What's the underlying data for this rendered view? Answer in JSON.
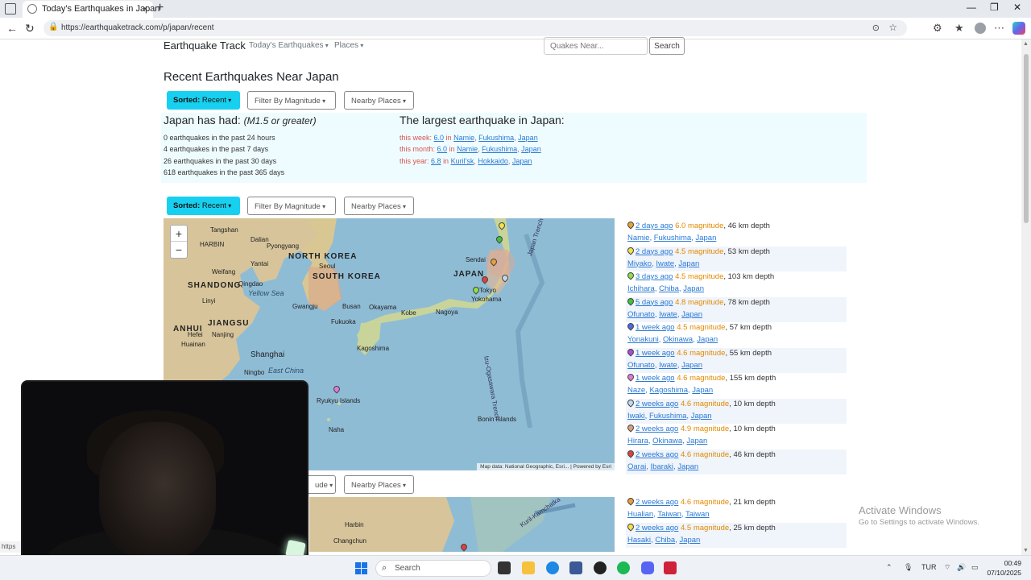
{
  "browser": {
    "tab_title": "Today's Earthquakes in Japan",
    "url": "https://earthquaketrack.com/p/japan/recent",
    "status_url": "https"
  },
  "navbar": {
    "brand": "Earthquake Track",
    "links": [
      "Today's Earthquakes",
      "Places"
    ],
    "search_placeholder": "Quakes Near...",
    "search_button": "Search"
  },
  "page": {
    "title": "Recent Earthquakes Near Japan"
  },
  "filters": {
    "sorted_label": "Sorted:",
    "sorted_value": "Recent",
    "magnitude": "Filter By Magnitude",
    "places": "Nearby Places",
    "magnitude_cut": "ude"
  },
  "stats": {
    "heading": "Japan has had:",
    "heading_note": "(M1.5 or greater)",
    "lines": [
      "0 earthquakes in the past 24 hours",
      "4 earthquakes in the past 7 days",
      "26 earthquakes in the past 30 days",
      "618 earthquakes in the past 365 days"
    ]
  },
  "largest": {
    "heading": "The largest earthquake in Japan:",
    "rows": [
      {
        "label": "this week:",
        "mag": "6.0",
        "sep": "in",
        "place": [
          "Namie",
          "Fukushima",
          "Japan"
        ]
      },
      {
        "label": "this month:",
        "mag": "6.0",
        "sep": "in",
        "place": [
          "Namie",
          "Fukushima",
          "Japan"
        ]
      },
      {
        "label": "this year:",
        "mag": "6.8",
        "sep": "in",
        "place": [
          "Kuril'sk",
          "Hokkaido",
          "Japan"
        ]
      }
    ]
  },
  "map": {
    "labels": [
      "HARBIN",
      "Tangshan",
      "Dalian",
      "Pyongyang",
      "NORTH KOREA",
      "Yantai",
      "Seoul",
      "SOUTH KOREA",
      "Busan",
      "Gwangju",
      "Qingdao",
      "Yellow Sea",
      "Weifang",
      "Linyi",
      "SHANDONG",
      "JAPAN",
      "Sendai",
      "Tokyo",
      "Kobe",
      "Okayama",
      "Nagoya",
      "Yokohama",
      "Fukuoka",
      "Kagoshima",
      "ANHUI",
      "JIANGSU",
      "Nanjing",
      "Hefei",
      "Huainan",
      "Shanghai",
      "Ningbo",
      "East China",
      "Ryukyu Islands",
      "Naha",
      "Bonin Islands",
      "Izu-Ogasawara Trench",
      "Japan Trench"
    ],
    "attribution": "Map data: National Geographic, Esri... | Powered by Esri",
    "map2_labels": [
      "Harbin",
      "Changchun",
      "Kuril-Kamchatka"
    ]
  },
  "quakes": [
    {
      "ago": "2 days ago",
      "mag": "6.0",
      "mag_label": "magnitude",
      "depth": ", 46 km depth",
      "place": [
        "Namie",
        "Fukushima",
        "Japan"
      ],
      "pin": "#e8a13a"
    },
    {
      "ago": "2 days ago",
      "mag": "4.5",
      "mag_label": "magnitude",
      "depth": ", 53 km depth",
      "place": [
        "Miyako",
        "Iwate",
        "Japan"
      ],
      "pin": "#f4e14b"
    },
    {
      "ago": "3 days ago",
      "mag": "4.5",
      "mag_label": "magnitude",
      "depth": ", 103 km depth",
      "place": [
        "Ichihara",
        "Chiba",
        "Japan"
      ],
      "pin": "#8be04b"
    },
    {
      "ago": "5 days ago",
      "mag": "4.8",
      "mag_label": "magnitude",
      "depth": ", 78 km depth",
      "place": [
        "Ofunato",
        "Iwate",
        "Japan"
      ],
      "pin": "#3cc43c"
    },
    {
      "ago": "1 week ago",
      "mag": "4.5",
      "mag_label": "magnitude",
      "depth": ", 57 km depth",
      "place": [
        "Yonakuni",
        "Okinawa",
        "Japan"
      ],
      "pin": "#4a6be0"
    },
    {
      "ago": "1 week ago",
      "mag": "4.6",
      "mag_label": "magnitude",
      "depth": ", 55 km depth",
      "place": [
        "Ofunato",
        "Iwate",
        "Japan"
      ],
      "pin": "#b04ad0"
    },
    {
      "ago": "1 week ago",
      "mag": "4.6",
      "mag_label": "magnitude",
      "depth": ", 155 km depth",
      "place": [
        "Naze",
        "Kagoshima",
        "Japan"
      ],
      "pin": "#e07ad6"
    },
    {
      "ago": "2 weeks ago",
      "mag": "4.6",
      "mag_label": "magnitude",
      "depth": ", 10 km depth",
      "place": [
        "Iwaki",
        "Fukushima",
        "Japan"
      ],
      "pin": "#c0d8f0"
    },
    {
      "ago": "2 weeks ago",
      "mag": "4.9",
      "mag_label": "magnitude",
      "depth": ", 10 km depth",
      "place": [
        "Hirara",
        "Okinawa",
        "Japan"
      ],
      "pin": "#d9a080"
    },
    {
      "ago": "2 weeks ago",
      "mag": "4.6",
      "mag_label": "magnitude",
      "depth": ", 46 km depth",
      "place": [
        "Oarai",
        "Ibaraki",
        "Japan"
      ],
      "pin": "#e04040"
    }
  ],
  "quakes2": [
    {
      "ago": "2 weeks ago",
      "mag": "4.6",
      "mag_label": "magnitude",
      "depth": ", 21 km depth",
      "place": [
        "Hualian",
        "Taiwan",
        "Taiwan"
      ],
      "pin": "#e8a13a"
    },
    {
      "ago": "2 weeks ago",
      "mag": "4.5",
      "mag_label": "magnitude",
      "depth": ", 25 km depth",
      "place": [
        "Hasaki",
        "Chiba",
        "Japan"
      ],
      "pin": "#f4e14b"
    }
  ],
  "watermark": {
    "line1": "Activate Windows",
    "line2": "Go to Settings to activate Windows."
  },
  "taskbar": {
    "search": "Search",
    "lang": "TUR",
    "time": "00:49",
    "date": "07/10/2025"
  }
}
